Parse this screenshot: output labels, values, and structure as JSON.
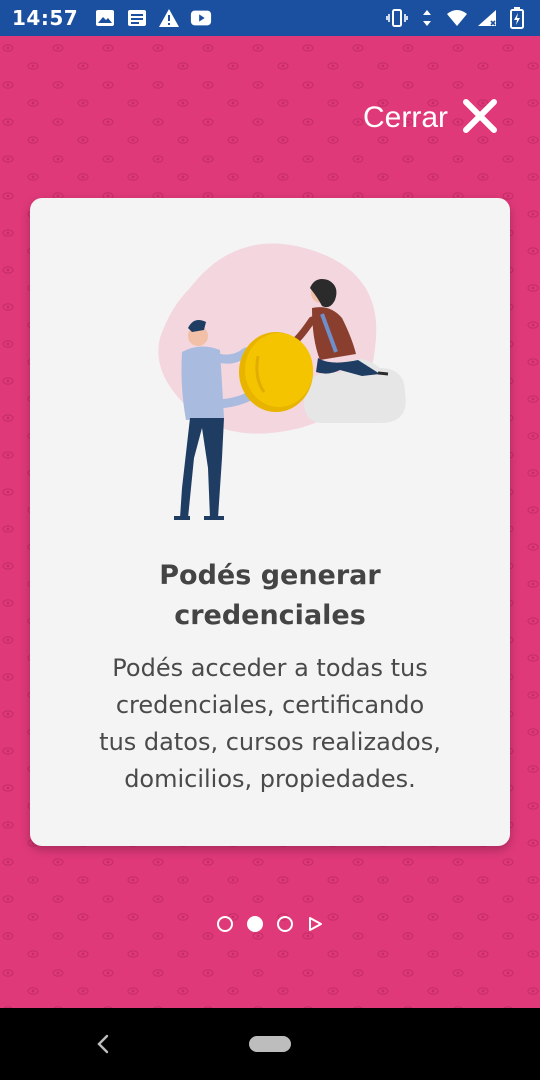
{
  "status_bar": {
    "time": "14:57",
    "left_icons": [
      "image-icon",
      "news-icon",
      "warning-icon",
      "youtube-icon"
    ],
    "right_icons": [
      "vibrate-icon",
      "data-arrows-icon",
      "wifi-icon",
      "signal-icon",
      "battery-icon"
    ]
  },
  "header": {
    "close_label": "Cerrar",
    "close_icon": "close-icon"
  },
  "card": {
    "title": "Podés generar\ncredenciales",
    "body": "Podés acceder a todas tus\ncredenciales, certificando\ntus datos, cursos realizados,\ndomicilios, propiedades."
  },
  "pager": {
    "pages": 3,
    "active_index": 1,
    "next_icon": "play-arrow-icon"
  },
  "navigation": {
    "back_icon": "chevron-left-icon",
    "home_icon": "home-pill-icon"
  },
  "colors": {
    "status_bar": "#1b4fa0",
    "background": "#e0397a",
    "card": "#f4f4f4",
    "coin": "#f5c400",
    "text": "#444444"
  }
}
